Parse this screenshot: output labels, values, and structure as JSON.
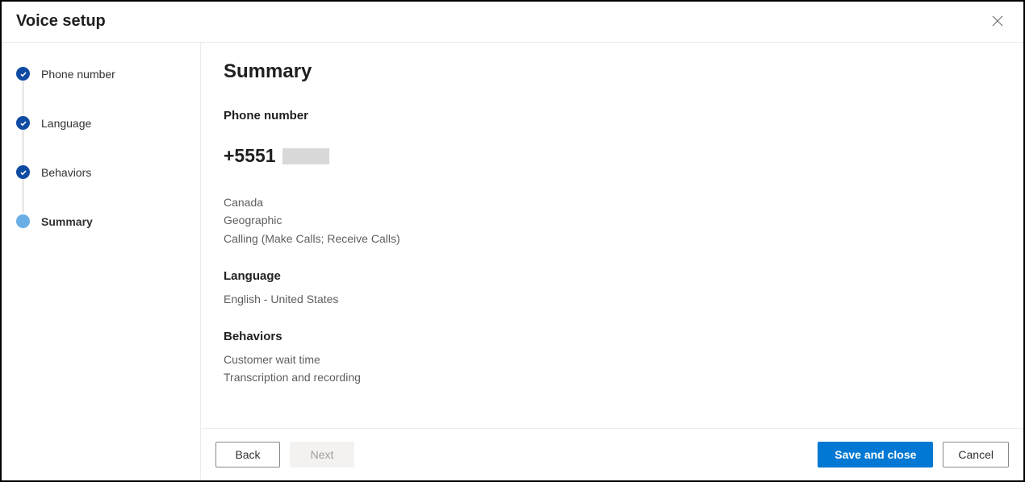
{
  "dialog": {
    "title": "Voice setup"
  },
  "steps": [
    {
      "label": "Phone number",
      "state": "done"
    },
    {
      "label": "Language",
      "state": "done"
    },
    {
      "label": "Behaviors",
      "state": "done"
    },
    {
      "label": "Summary",
      "state": "current"
    }
  ],
  "summary": {
    "title": "Summary",
    "phone": {
      "heading": "Phone number",
      "number_visible": "+5551",
      "country": "Canada",
      "type": "Geographic",
      "capabilities": "Calling (Make Calls; Receive Calls)"
    },
    "language": {
      "heading": "Language",
      "value": "English - United States"
    },
    "behaviors": {
      "heading": "Behaviors",
      "items": [
        "Customer wait time",
        "Transcription and recording"
      ]
    }
  },
  "footer": {
    "back": "Back",
    "next": "Next",
    "save": "Save and close",
    "cancel": "Cancel"
  }
}
